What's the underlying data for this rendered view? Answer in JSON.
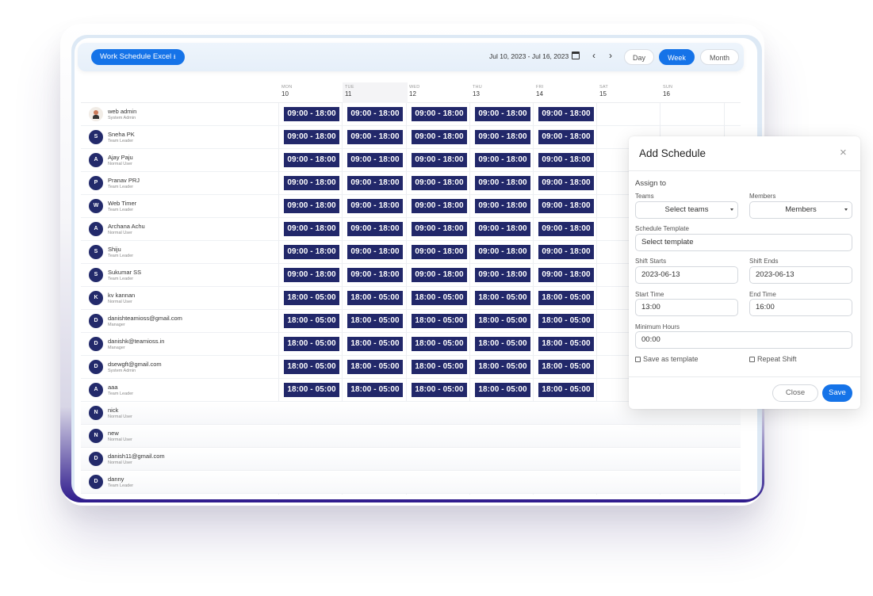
{
  "toolbar": {
    "excel_label": "Work Schedule Excel",
    "date_range": "Jul 10, 2023 - Jul 16, 2023",
    "prev": "‹",
    "next": "›",
    "view_day": "Day",
    "view_week": "Week",
    "view_month": "Month"
  },
  "days": [
    {
      "name": "MON",
      "num": "10"
    },
    {
      "name": "TUE",
      "num": "11"
    },
    {
      "name": "WED",
      "num": "12"
    },
    {
      "name": "THU",
      "num": "13"
    },
    {
      "name": "FRI",
      "num": "14"
    },
    {
      "name": "SAT",
      "num": "15"
    },
    {
      "name": "SUN",
      "num": "16"
    }
  ],
  "users": [
    {
      "initial": "",
      "name": "web admin",
      "role": "System Admin",
      "shift": "09:00 - 18:00"
    },
    {
      "initial": "S",
      "name": "Sneha PK",
      "role": "Team Leader",
      "shift": "09:00 - 18:00"
    },
    {
      "initial": "A",
      "name": "Ajay Paju",
      "role": "Normal User",
      "shift": "09:00 - 18:00"
    },
    {
      "initial": "P",
      "name": "Pranav PRJ",
      "role": "Team Leader",
      "shift": "09:00 - 18:00"
    },
    {
      "initial": "W",
      "name": "Web Timer",
      "role": "Team Leader",
      "shift": "09:00 - 18:00"
    },
    {
      "initial": "A",
      "name": "Archana Achu",
      "role": "Normal User",
      "shift": "09:00 - 18:00"
    },
    {
      "initial": "S",
      "name": "Shiju",
      "role": "Team Leader",
      "shift": "09:00 - 18:00"
    },
    {
      "initial": "S",
      "name": "Sukumar SS",
      "role": "Team Leader",
      "shift": "09:00 - 18:00"
    },
    {
      "initial": "K",
      "name": "kv kannan",
      "role": "Normal User",
      "shift": "18:00 - 05:00"
    },
    {
      "initial": "D",
      "name": "danishteamioss@gmail.com",
      "role": "Manager",
      "shift": "18:00 - 05:00"
    },
    {
      "initial": "D",
      "name": "danishk@teamioss.in",
      "role": "Manager",
      "shift": "18:00 - 05:00"
    },
    {
      "initial": "D",
      "name": "dsewgft@gmail.com",
      "role": "System Admin",
      "shift": "18:00 - 05:00"
    },
    {
      "initial": "A",
      "name": "aaa",
      "role": "Team Leader",
      "shift": "18:00 - 05:00"
    },
    {
      "initial": "N",
      "name": "nick",
      "role": "Normal User",
      "shift": ""
    },
    {
      "initial": "N",
      "name": "new",
      "role": "Normal User",
      "shift": ""
    },
    {
      "initial": "D",
      "name": "danish11@gmail.com",
      "role": "Normal User",
      "shift": ""
    },
    {
      "initial": "D",
      "name": "danny",
      "role": "Team Leader",
      "shift": ""
    }
  ],
  "modal": {
    "title": "Add Schedule",
    "close_icon": "×",
    "assign_to": "Assign to",
    "teams_label": "Teams",
    "teams_value": "Select teams",
    "members_label": "Members",
    "members_value": "Members",
    "template_label": "Schedule Template",
    "template_value": "Select template",
    "shift_starts_label": "Shift Starts",
    "shift_starts_value": "2023-06-13",
    "shift_ends_label": "Shift Ends",
    "shift_ends_value": "2023-06-13",
    "start_time_label": "Start Time",
    "start_time_value": "13:00",
    "end_time_label": "End Time",
    "end_time_value": "16:00",
    "min_hours_label": "Minimum Hours",
    "min_hours_value": "00:00",
    "save_template_label": "Save as template",
    "repeat_shift_label": "Repeat Shift",
    "close_button": "Close",
    "save_button": "Save"
  }
}
